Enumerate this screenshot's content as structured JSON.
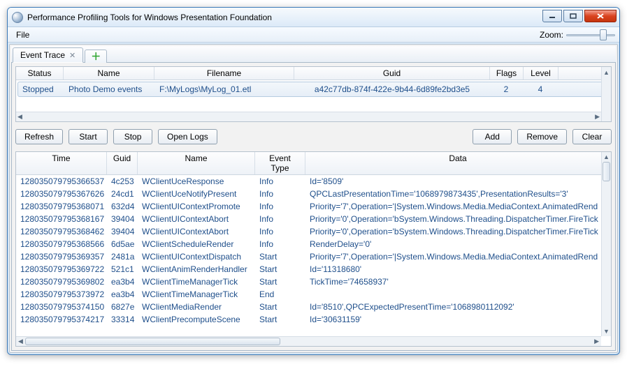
{
  "window": {
    "title": "Performance Profiling Tools for Windows Presentation Foundation"
  },
  "menubar": {
    "file": "File",
    "zoom_label": "Zoom:"
  },
  "tabs": {
    "event_trace": "Event Trace"
  },
  "trace_grid": {
    "headers": {
      "status": "Status",
      "name": "Name",
      "filename": "Filename",
      "guid": "Guid",
      "flags": "Flags",
      "level": "Level"
    },
    "row": {
      "status": "Stopped",
      "name": "Photo Demo events",
      "filename": "F:\\MyLogs\\MyLog_01.etl",
      "guid": "a42c77db-874f-422e-9b44-6d89fe2bd3e5",
      "flags": "2",
      "level": "4"
    }
  },
  "buttons": {
    "refresh": "Refresh",
    "start": "Start",
    "stop": "Stop",
    "open_logs": "Open Logs",
    "add": "Add",
    "remove": "Remove",
    "clear": "Clear"
  },
  "events_grid": {
    "headers": {
      "time": "Time",
      "guid": "Guid",
      "name": "Name",
      "event_type": "Event Type",
      "data": "Data"
    },
    "rows": [
      {
        "time": "128035079795366537",
        "guid": "4c253",
        "name": "WClientUceResponse",
        "type": "Info",
        "data": "Id='8509'"
      },
      {
        "time": "128035079795367626",
        "guid": "24cd1",
        "name": "WClientUceNotifyPresent",
        "type": "Info",
        "data": "QPCLastPresentationTime='1068979873435',PresentationResults='3'"
      },
      {
        "time": "128035079795368071",
        "guid": "632d4",
        "name": "WClientUIContextPromote",
        "type": "Info",
        "data": "Priority='7',Operation='|System.Windows.Media.MediaContext.AnimatedRend"
      },
      {
        "time": "128035079795368167",
        "guid": "39404",
        "name": "WClientUIContextAbort",
        "type": "Info",
        "data": "Priority='0',Operation='bSystem.Windows.Threading.DispatcherTimer.FireTick"
      },
      {
        "time": "128035079795368462",
        "guid": "39404",
        "name": "WClientUIContextAbort",
        "type": "Info",
        "data": "Priority='0',Operation='bSystem.Windows.Threading.DispatcherTimer.FireTick"
      },
      {
        "time": "128035079795368566",
        "guid": "6d5ae",
        "name": "WClientScheduleRender",
        "type": "Info",
        "data": "RenderDelay='0'"
      },
      {
        "time": "128035079795369357",
        "guid": "2481a",
        "name": "WClientUIContextDispatch",
        "type": "Start",
        "data": "Priority='7',Operation='|System.Windows.Media.MediaContext.AnimatedRend"
      },
      {
        "time": "128035079795369722",
        "guid": "521c1",
        "name": "WClientAnimRenderHandler",
        "type": "Start",
        "data": "Id='11318680'"
      },
      {
        "time": "128035079795369802",
        "guid": "ea3b4",
        "name": "WClientTimeManagerTick",
        "type": "Start",
        "data": "TickTime='74658937'"
      },
      {
        "time": "128035079795373972",
        "guid": "ea3b4",
        "name": "WClientTimeManagerTick",
        "type": "End",
        "data": ""
      },
      {
        "time": "128035079795374150",
        "guid": "6827e",
        "name": "WClientMediaRender",
        "type": "Start",
        "data": "Id='8510',QPCExpectedPresentTime='1068980112092'"
      },
      {
        "time": "128035079795374217",
        "guid": "33314",
        "name": "WClientPrecomputeScene",
        "type": "Start",
        "data": "Id='30631159'"
      }
    ]
  }
}
